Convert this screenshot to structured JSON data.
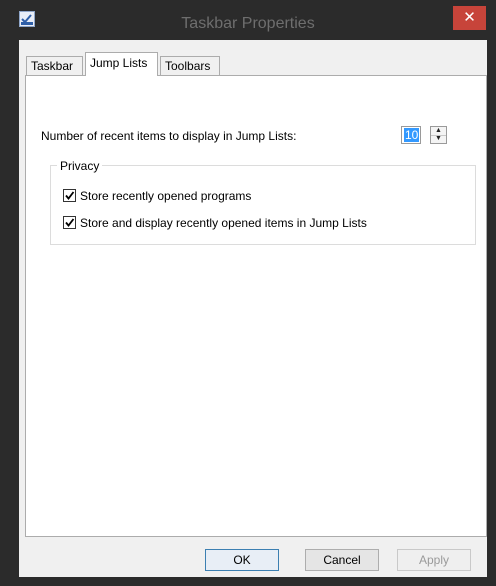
{
  "window": {
    "title": "Taskbar Properties",
    "close_label": "✕",
    "icon": "checkbox-app-icon"
  },
  "tabs": [
    {
      "label": "Taskbar",
      "active": false
    },
    {
      "label": "Jump Lists",
      "active": true
    },
    {
      "label": "Toolbars",
      "active": false
    }
  ],
  "jump_lists": {
    "count_label": "Number of recent items to display in Jump Lists:",
    "count_value": "10",
    "privacy": {
      "title": "Privacy",
      "options": [
        {
          "label": "Store recently opened programs",
          "checked": true
        },
        {
          "label": "Store and display recently opened items in Jump Lists",
          "checked": true
        }
      ]
    }
  },
  "buttons": {
    "ok": "OK",
    "cancel": "Cancel",
    "apply": "Apply"
  },
  "colors": {
    "window_frame": "#2b2b2b",
    "close_button": "#c7443a",
    "selection": "#3399ff"
  }
}
